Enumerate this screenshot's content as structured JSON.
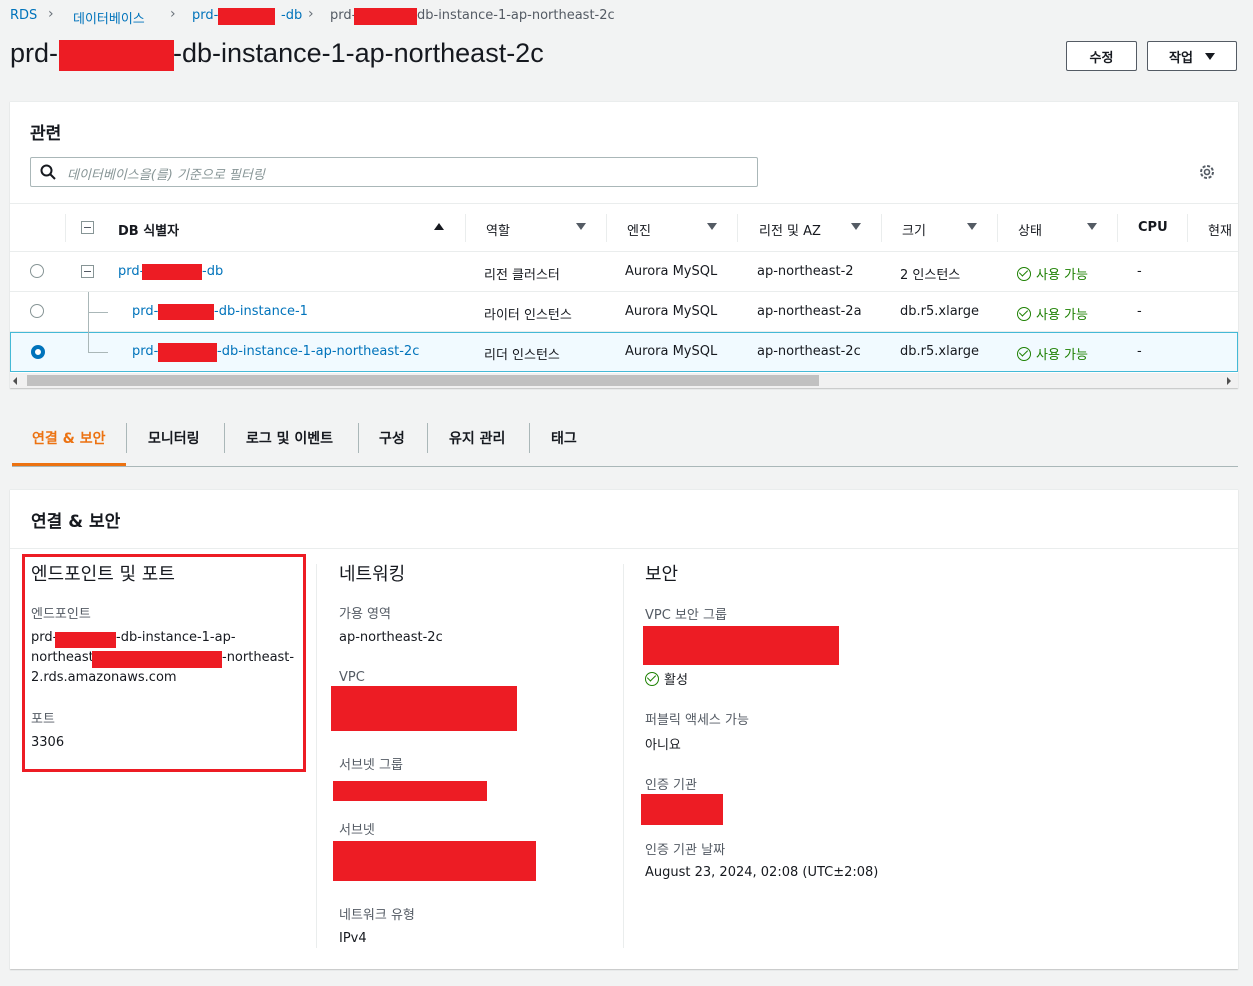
{
  "breadcrumb": {
    "rds": "RDS",
    "databases": "데이터베이스",
    "cluster_prefix": "prd-",
    "cluster_suffix": "-db",
    "instance_prefix": "prd-",
    "instance_suffix": "db-instance-1-ap-northeast-2c"
  },
  "title": {
    "prefix": "prd-",
    "suffix": "-db-instance-1-ap-northeast-2c"
  },
  "actions": {
    "modify": "수정",
    "actions": "작업"
  },
  "related": {
    "heading": "관련",
    "search_placeholder": "데이터베이스을(를) 기준으로 필터링",
    "columns": {
      "id": "DB 식별자",
      "role": "역할",
      "engine": "엔진",
      "region": "리전 및 AZ",
      "size": "크기",
      "status": "상태",
      "cpu": "CPU",
      "current": "현재"
    },
    "rows": [
      {
        "id_prefix": "prd-",
        "id_suffix": "-db",
        "role": "리전 클러스터",
        "engine": "Aurora MySQL",
        "region": "ap-northeast-2",
        "size": "2 인스턴스",
        "status": "사용 가능",
        "cpu": "-",
        "selected": false
      },
      {
        "id_prefix": "prd-",
        "id_suffix": "-db-instance-1",
        "role": "라이터 인스턴스",
        "engine": "Aurora MySQL",
        "region": "ap-northeast-2a",
        "size": "db.r5.xlarge",
        "status": "사용 가능",
        "cpu": "-",
        "selected": false
      },
      {
        "id_prefix": "prd-",
        "id_suffix": "-db-instance-1-ap-northeast-2c",
        "role": "리더 인스턴스",
        "engine": "Aurora MySQL",
        "region": "ap-northeast-2c",
        "size": "db.r5.xlarge",
        "status": "사용 가능",
        "cpu": "-",
        "selected": true
      }
    ]
  },
  "tabs": [
    "연결 & 보안",
    "모니터링",
    "로그 및 이벤트",
    "구성",
    "유지 관리",
    "태그"
  ],
  "connectivity": {
    "heading": "연결 & 보안",
    "endpoint_section": "엔드포인트 및 포트",
    "endpoint_label": "엔드포인트",
    "endpoint_line1_prefix": "prd-",
    "endpoint_line1_suffix": "-db-instance-1-ap-",
    "endpoint_line2_prefix": "northeast",
    "endpoint_line2_suffix": "-northeast-",
    "endpoint_line3": "2.rds.amazonaws.com",
    "port_label": "포트",
    "port": "3306",
    "network_section": "네트워킹",
    "az_label": "가용 영역",
    "az": "ap-northeast-2c",
    "vpc_label": "VPC",
    "subnet_group_label": "서브넷 그룹",
    "subnets_label": "서브넷",
    "network_type_label": "네트워크 유형",
    "network_type": "IPv4",
    "security_section": "보안",
    "sg_label": "VPC 보안 그룹",
    "sg_status": "활성",
    "public_label": "퍼블릭 액세스 가능",
    "public": "아니요",
    "ca_label": "인증 기관",
    "ca_date_label": "인증 기관 날짜",
    "ca_date": "August 23, 2024, 02:08 (UTC±2:08)"
  },
  "colors": {
    "accent": "#ec7211",
    "link": "#0073bb",
    "success": "#1d8102",
    "redaction": "#ed1c24"
  }
}
